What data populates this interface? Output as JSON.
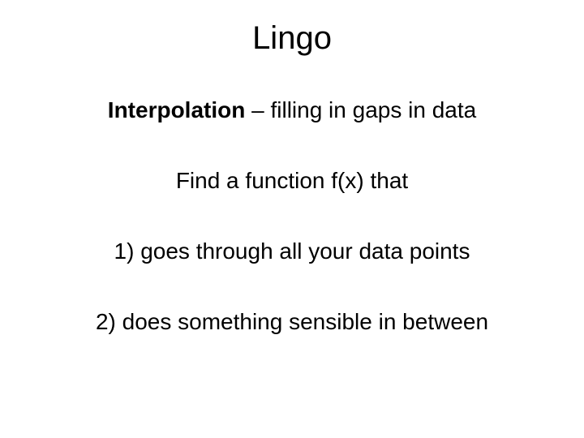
{
  "title": "Lingo",
  "definition_term": "Interpolation",
  "definition_rest": " – filling in gaps in data",
  "line2": "Find a function f(x) that",
  "line3": "1) goes through all your data points",
  "line4": "2) does something sensible in between"
}
